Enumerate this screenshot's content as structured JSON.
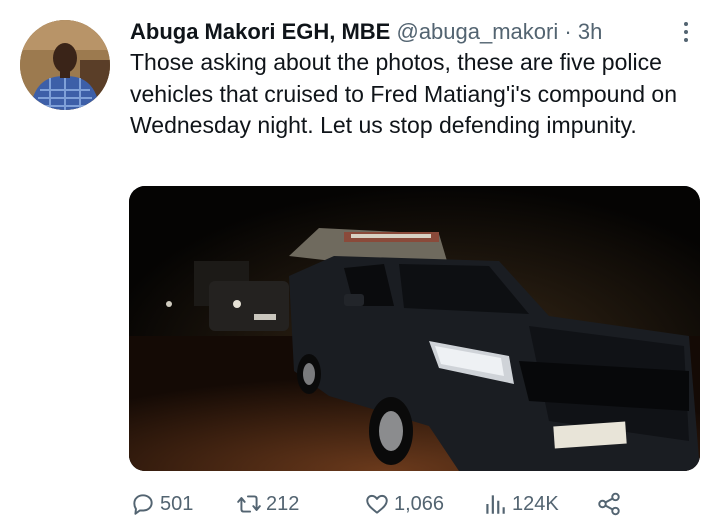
{
  "tweet": {
    "display_name": "Abuga Makori EGH, MBE",
    "handle": "@abuga_makori",
    "separator": "·",
    "time": "3h",
    "text": "Those asking about the photos, these are five police vehicles that cruised to Fred Matiang'i's compound on Wednesday night. Let us stop defending impunity.",
    "media_description_icon": "photo"
  },
  "actions": {
    "replies": "501",
    "retweets": "212",
    "likes": "1,066",
    "views": "124K"
  },
  "icons": {
    "more": "more-vertical-icon",
    "reply": "reply-icon",
    "retweet": "retweet-icon",
    "like": "heart-icon",
    "views": "views-icon",
    "share": "share-icon"
  },
  "colors": {
    "text": "#0f1419",
    "muted": "#536471"
  }
}
